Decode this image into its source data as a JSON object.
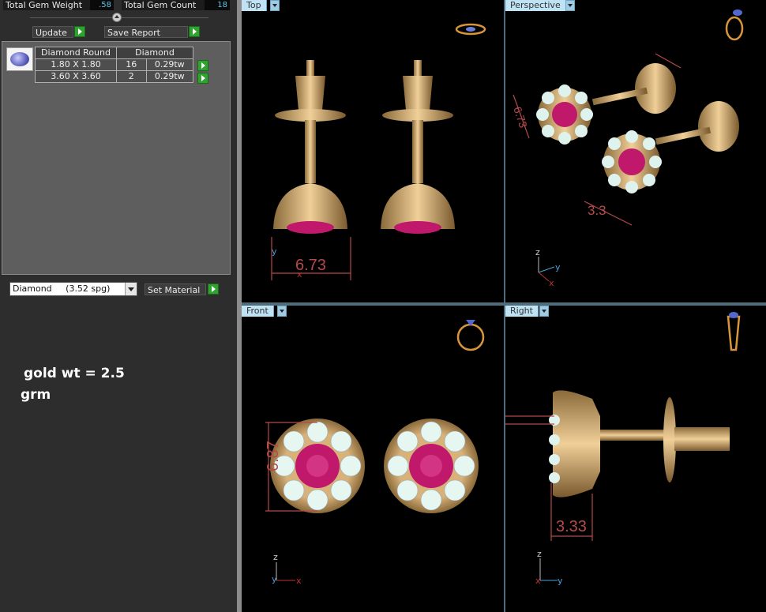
{
  "stats": {
    "total_weight_label": "Total Gem Weight",
    "total_weight_value": ".58",
    "total_count_label": "Total Gem Count",
    "total_count_value": "18"
  },
  "toolbar": {
    "update_label": "Update",
    "save_report_label": "Save Report"
  },
  "gem_table": {
    "headers": [
      "Diamond Round",
      "Diamond"
    ],
    "rows": [
      {
        "size": "1.80 X 1.80",
        "count": "16",
        "weight": "0.29tw"
      },
      {
        "size": "3.60 X 3.60",
        "count": "2",
        "weight": "0.29tw"
      }
    ]
  },
  "material": {
    "selected": "Diamond     (3.52 spg)",
    "set_label": "Set Material"
  },
  "note": {
    "line1": "gold wt = 2.5",
    "line2": "grm"
  },
  "viewports": {
    "top": {
      "label": "Top",
      "dimension": "6.73",
      "axis_y": "y",
      "axis_x": "x"
    },
    "perspective": {
      "label": "Perspective",
      "dimension1": "6.73",
      "dimension2": "3.3",
      "axis_z": "z",
      "axis_y": "y",
      "axis_x": "x"
    },
    "front": {
      "label": "Front",
      "dimension": "6.87",
      "axis_z": "z",
      "axis_y": "y",
      "axis_x": "x"
    },
    "right": {
      "label": "Right",
      "dimension": "3.33",
      "axis_z": "z",
      "axis_x": "x",
      "axis_y": "y"
    }
  },
  "colors": {
    "viewport_tab": "#bfe3f5",
    "dimension": "#b54a4a",
    "gold": "#d9b27a",
    "ruby": "#c0186a",
    "diamond": "#dff3ee"
  }
}
